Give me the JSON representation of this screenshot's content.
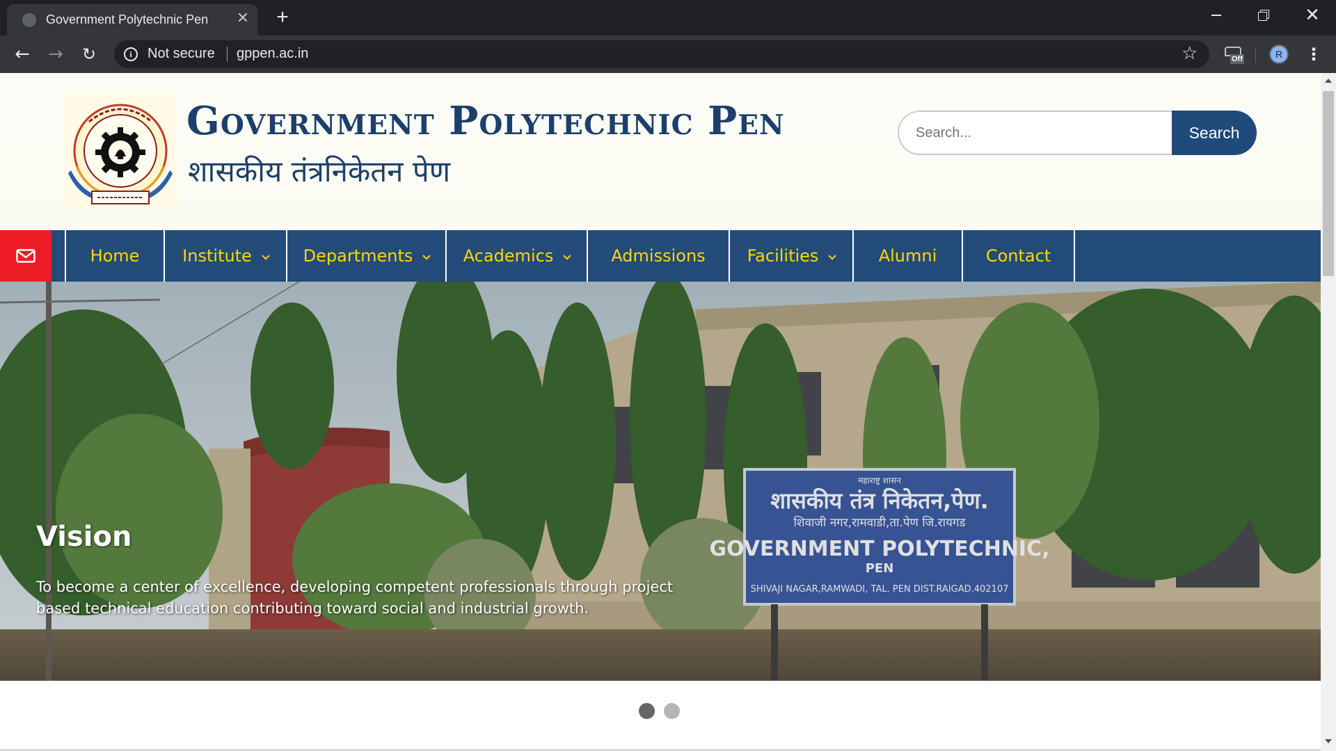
{
  "browser": {
    "tab_title": "Government Polytechnic Pen",
    "tab_close": "✕",
    "new_tab": "+",
    "security_label": "Not secure",
    "url": "gppen.ac.in",
    "extension_badge": "Off",
    "profile_initial": "R",
    "icons": {
      "back": "arrow-left-icon",
      "forward": "arrow-right-icon",
      "reload": "reload-icon",
      "info": "info-icon",
      "star": "star-icon",
      "menu": "kebab-menu-icon"
    }
  },
  "header": {
    "title": "Government Polytechnic Pen",
    "subtitle": "शासकीय तंत्रनिकेतन पेण",
    "logo_alt": "college emblem",
    "search": {
      "placeholder": "Search...",
      "value": "",
      "button_label": "Search"
    }
  },
  "navbar": {
    "mail_icon": "envelope-icon",
    "items": [
      {
        "label": "Home",
        "has_dropdown": false
      },
      {
        "label": "Institute",
        "has_dropdown": true
      },
      {
        "label": "Departments",
        "has_dropdown": true
      },
      {
        "label": "Academics",
        "has_dropdown": true
      },
      {
        "label": "Admissions",
        "has_dropdown": false
      },
      {
        "label": "Facilities",
        "has_dropdown": true
      },
      {
        "label": "Alumni",
        "has_dropdown": false
      },
      {
        "label": "Contact",
        "has_dropdown": false
      }
    ]
  },
  "hero": {
    "heading": "Vision",
    "text": "To become a center of excellence, developing competent professionals through project based technical education contributing toward social and industrial growth.",
    "sign": {
      "line1": "महाराष्ट्र शासन",
      "line2": "शासकीय तंत्र निकेतन,पेण.",
      "line3": "शिवाजी नगर,रामवाडी,ता.पेण जि.रायगड",
      "line4": "GOVERNMENT POLYTECHNIC,",
      "line5": "PEN",
      "line6": "SHIVAJI NAGAR,RAMWADI, TAL. PEN DIST.RAIGAD.402107"
    }
  },
  "carousel": {
    "active_slide": 1,
    "slide_count": 2
  },
  "colors": {
    "nav_bg": "#234b79",
    "nav_text": "#ffd700",
    "title": "#1c3f6b",
    "mail_button": "#ee1c24",
    "search_button": "#1f4a7a"
  }
}
